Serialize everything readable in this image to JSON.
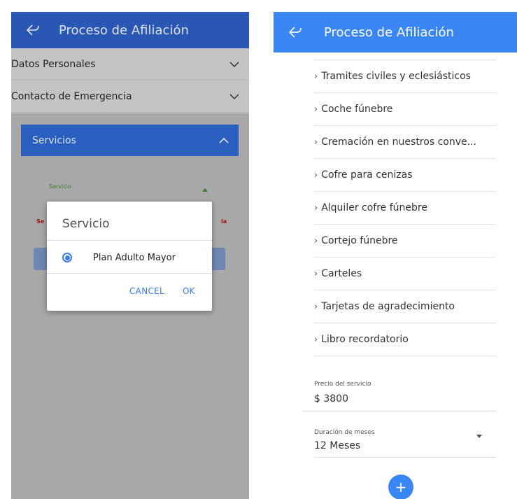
{
  "left": {
    "header_title": "Proceso de Afiliación",
    "accordion": [
      {
        "label": "Datos Personales"
      },
      {
        "label": "Contacto de Emergencia"
      }
    ],
    "servicios_label": "Servicios",
    "servicio_field_label": "Servicio",
    "red_left_text": "Se",
    "red_right_text": "la",
    "dialog": {
      "title": "Servicio",
      "option": "Plan Adulto Mayor",
      "cancel": "CANCEL",
      "ok": "OK"
    }
  },
  "right": {
    "header_title": "Proceso de Afiliación",
    "items": [
      {
        "label": "Tramites civiles y eclesiásticos"
      },
      {
        "label": "Coche fúnebre"
      },
      {
        "label": "Cremación en nuestros conve..."
      },
      {
        "label": "Cofre para cenizas"
      },
      {
        "label": "Alquiler cofre fúnebre"
      },
      {
        "label": "Cortejo fúnebre"
      },
      {
        "label": "Carteles"
      },
      {
        "label": "Tarjetas de agradecimiento"
      },
      {
        "label": "Libro recordatorio"
      }
    ],
    "price_label": "Precio del servicio",
    "price_value": "$ 3800",
    "duration_label": "Duración de meses",
    "duration_value": "12 Meses",
    "fab_label": "+"
  },
  "colors": {
    "left_header": "#2a56b4",
    "right_header": "#3b86f5",
    "accent": "#3b7cf0"
  }
}
